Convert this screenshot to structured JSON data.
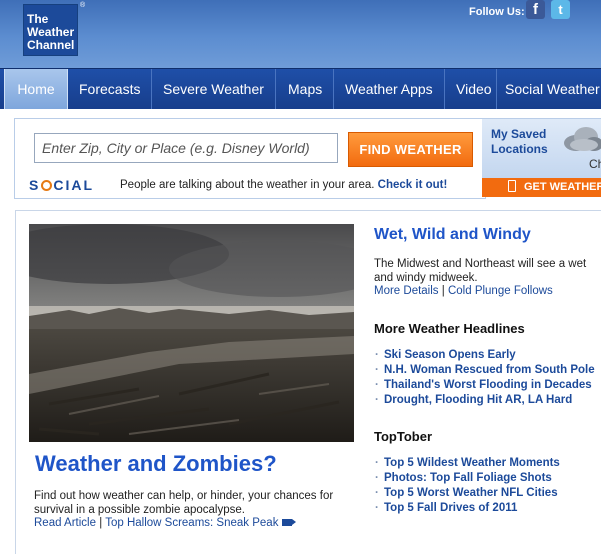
{
  "header": {
    "logo_lines": [
      "The",
      "Weather",
      "Channel"
    ],
    "logo_registered": "®",
    "follow_label": "Follow Us:",
    "facebook_glyph": "f",
    "twitter_glyph": "t"
  },
  "nav": {
    "items": [
      {
        "label": "Home",
        "active": true
      },
      {
        "label": "Forecasts"
      },
      {
        "label": "Severe Weather"
      },
      {
        "label": "Maps"
      },
      {
        "label": "Weather Apps"
      },
      {
        "label": "Video"
      },
      {
        "label": "Social Weather"
      }
    ]
  },
  "search": {
    "placeholder": "Enter Zip, City or Place (e.g. Disney World)",
    "button_label": "FIND WEATHER"
  },
  "social": {
    "logo_pre": "S",
    "logo_post": "CIAL",
    "text": "People are talking about the weather in your area.",
    "link": "Check it out!"
  },
  "saved": {
    "label": "My Saved Locations",
    "partial_text": "Ch",
    "get_weather": "GET WEATHER"
  },
  "hero": {
    "title": "Weather and Zombies?",
    "description": "Find out how weather can help, or hinder, your chances for survival in a possible zombie apocalypse.",
    "link1": "Read Article",
    "separator": "|",
    "link2": "Top Hallow Screams: Sneak Peak"
  },
  "sidebar_story": {
    "title": "Wet, Wild and Windy",
    "description": "The Midwest and Northeast will see a wet and windy midweek.",
    "link1": "More Details",
    "separator": "|",
    "link2": "Cold Plunge Follows"
  },
  "headlines": {
    "heading": "More Weather Headlines",
    "items": [
      "Ski Season Opens Early",
      "N.H. Woman Rescued from South Pole",
      "Thailand's Worst Flooding in Decades",
      "Drought, Flooding Hit AR, LA Hard"
    ]
  },
  "toptober": {
    "heading": "TopTober",
    "items": [
      "Top 5 Wildest Weather Moments",
      "Photos: Top Fall Foliage Shots",
      "Top 5 Worst Weather NFL Cities",
      "Top 5 Fall Drives of 2011"
    ]
  },
  "colors": {
    "brand_blue": "#1c4a9a",
    "link_blue": "#1f55c8",
    "accent_orange": "#f26b0f"
  }
}
